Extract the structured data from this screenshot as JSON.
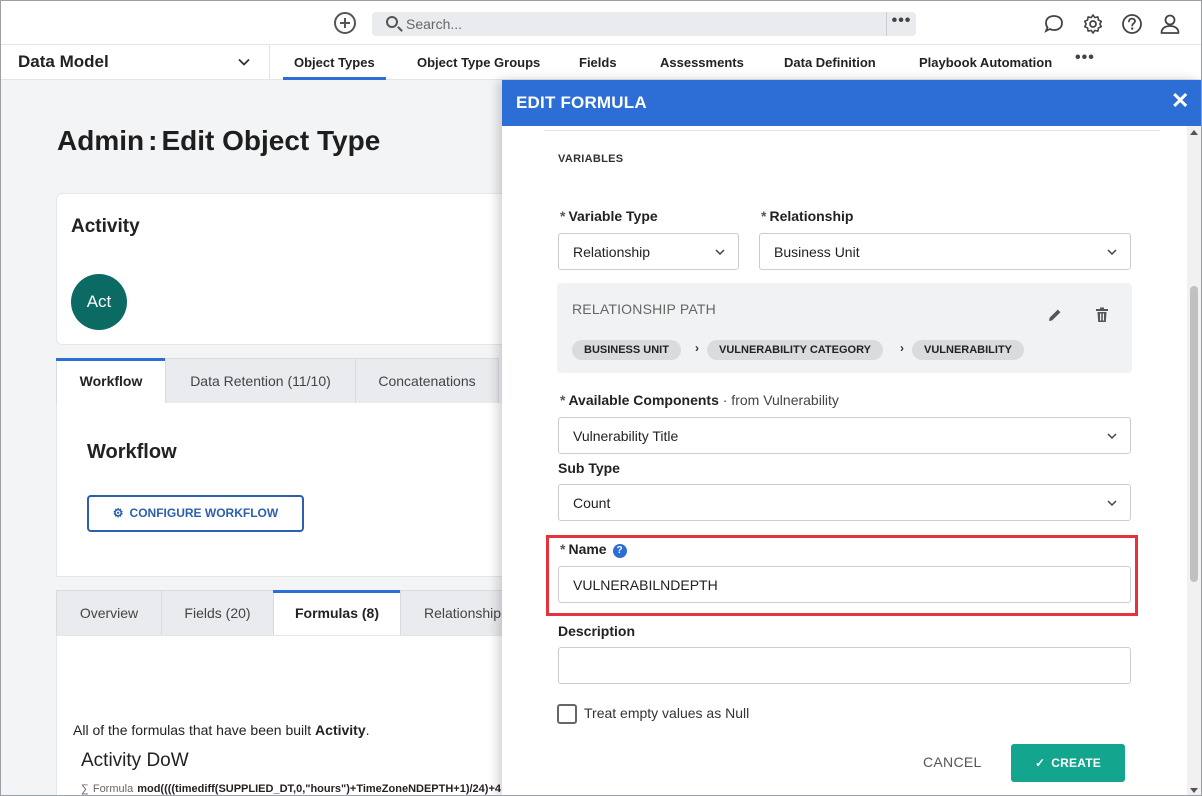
{
  "topbar": {
    "search_placeholder": "Search...",
    "more_label": "•••"
  },
  "nav": {
    "section": "Data Model",
    "items": [
      {
        "label": "Object Types",
        "active": true
      },
      {
        "label": "Object Type Groups"
      },
      {
        "label": "Fields"
      },
      {
        "label": "Assessments"
      },
      {
        "label": "Data Definition"
      },
      {
        "label": "Playbook Automation"
      }
    ],
    "more_label": "•••"
  },
  "page": {
    "title_prefix": "Admin",
    "title_rest": "Edit Object Type",
    "object_name": "Activity",
    "avatar_text": "Act",
    "tabs_top": [
      {
        "label": "Workflow",
        "active": true
      },
      {
        "label": "Data Retention (11/10)"
      },
      {
        "label": "Concatenations"
      }
    ],
    "workflow_heading": "Workflow",
    "configure_button": "CONFIGURE WORKFLOW",
    "tabs_bottom": [
      {
        "label": "Overview"
      },
      {
        "label": "Fields (20)"
      },
      {
        "label": "Formulas (8)",
        "active": true
      },
      {
        "label": "Relationship"
      }
    ],
    "formulas_desc_prefix": "All of the formulas that have been built ",
    "formulas_desc_object": "Activity",
    "formulas_desc_suffix": ".",
    "formula_title": "Activity DoW",
    "formula_label": "Formula",
    "formula_text": "mod((((timediff(SUPPLIED_DT,0,\"hours\")+TimeZoneNDEPTH+1)/24)+4"
  },
  "drawer": {
    "title": "EDIT FORMULA",
    "section_label": "VARIABLES",
    "variable_type_label": "Variable Type",
    "variable_type_value": "Relationship",
    "relationship_label": "Relationship",
    "relationship_value": "Business Unit",
    "relationship_path_label": "RELATIONSHIP PATH",
    "path_chips": [
      "BUSINESS UNIT",
      "VULNERABILITY CATEGORY",
      "VULNERABILITY"
    ],
    "path_separator": "›",
    "available_components_label": "Available Components",
    "available_components_suffix": " · from Vulnerability",
    "available_components_value": "Vulnerability Title",
    "sub_type_label": "Sub Type",
    "sub_type_value": "Count",
    "name_label": "Name",
    "name_value": "VULNERABILNDEPTH",
    "description_label": "Description",
    "description_value": "",
    "treat_empty_label": "Treat empty values as Null",
    "treat_empty_checked": false,
    "cancel_label": "CANCEL",
    "create_label": "CREATE",
    "help_glyph": "?",
    "required_glyph": "*",
    "accent_color": "#2c6ed5",
    "create_color": "#13a58d",
    "highlight_color": "#e5323d"
  }
}
